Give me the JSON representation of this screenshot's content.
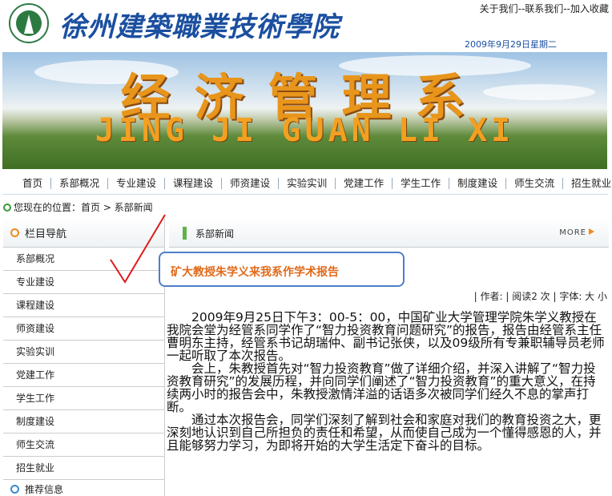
{
  "header": {
    "school_name": "徐州建築職業技術學院",
    "top_links": [
      "关于我们",
      "联系我们",
      "加入收藏"
    ],
    "link_separator": "--",
    "date": "2009年9月29日星期二"
  },
  "banner": {
    "title": "经济管理系",
    "pinyin": "JING JI GUAN LI XI"
  },
  "nav": {
    "items": [
      "首页",
      "系部概况",
      "专业建设",
      "课程建设",
      "师资建设",
      "实验实训",
      "党建工作",
      "学生工作",
      "制度建设",
      "师生交流",
      "招生就业"
    ]
  },
  "breadcrumb": {
    "text": "您现在的位置：首页 > 系部新闻"
  },
  "sidebar": {
    "heading": "栏目导航",
    "items": [
      "系部概况",
      "专业建设",
      "课程建设",
      "师资建设",
      "实验实训",
      "党建工作",
      "学生工作",
      "制度建设",
      "师生交流",
      "招生就业"
    ],
    "next_heading": "推荐信息"
  },
  "main": {
    "section_label": "系部新闻",
    "more_label": "MORE",
    "article_title": "矿大教授朱学义来我系作学术报告",
    "meta": "| 作者: | 阅读2 次 | 字体: 大 小",
    "paragraphs": [
      "2009年9月25日下午3：00-5：00，中国矿业大学管理学院朱学义教授在我院会堂为经管系同学作了“智力投资教育问题研究”的报告，报告由经管系主任曹明东主持，经管系书记胡瑞仲、副书记张侠，以及09级所有专兼职辅导员老师一起听取了本次报告。",
      "会上，朱教授首先对“智力投资教育”做了详细介绍，并深入讲解了“智力投资教育研究”的发展历程，并向同学们阐述了“智力投资教育”的重大意义，在持续两小时的报告会中，朱教授激情洋溢的话语多次被同学们经久不息的掌声打断。",
      "通过本次报告会，同学们深刻了解到社会和家庭对我们的教育投资之大，更深刻地认识到自己所担负的责任和希望，从而使自己成为一个懂得感恩的人，并且能够努力学习，为即将开始的大学生活定下奋斗的目标。"
    ]
  },
  "colors": {
    "brand_blue": "#1b4fa0",
    "title_orange": "#e06a1a",
    "highlight_border": "#4f7ec8",
    "check_red": "#e01818"
  }
}
